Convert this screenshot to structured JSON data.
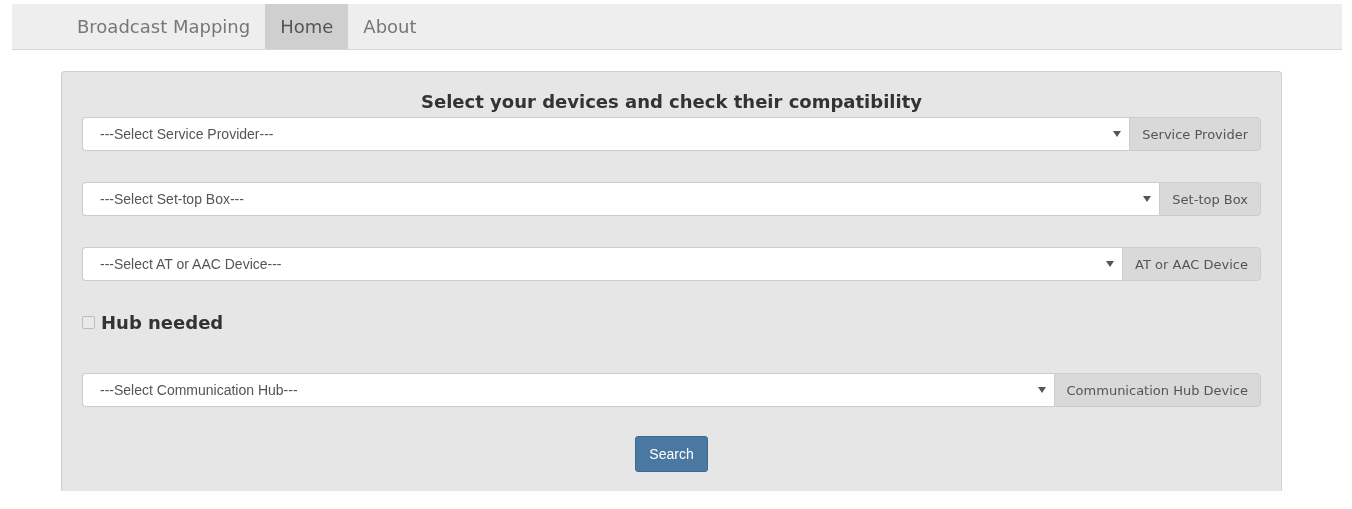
{
  "navbar": {
    "brand": "Broadcast Mapping",
    "tabs": [
      {
        "label": "Home",
        "selected": true
      },
      {
        "label": "About",
        "selected": false
      }
    ]
  },
  "form": {
    "title": "Select your devices and check their compatibility",
    "selects": [
      {
        "placeholder": "---Select Service Provider---",
        "addon": "Service Provider"
      },
      {
        "placeholder": "---Select Set-top Box---",
        "addon": "Set-top Box"
      },
      {
        "placeholder": "---Select AT or AAC Device---",
        "addon": "AT or AAC Device"
      }
    ],
    "hub": {
      "label": "Hub needed",
      "checked": false
    },
    "hub_select": {
      "placeholder": "---Select Communication Hub---",
      "addon": "Communication Hub Device"
    },
    "button": "Search"
  }
}
